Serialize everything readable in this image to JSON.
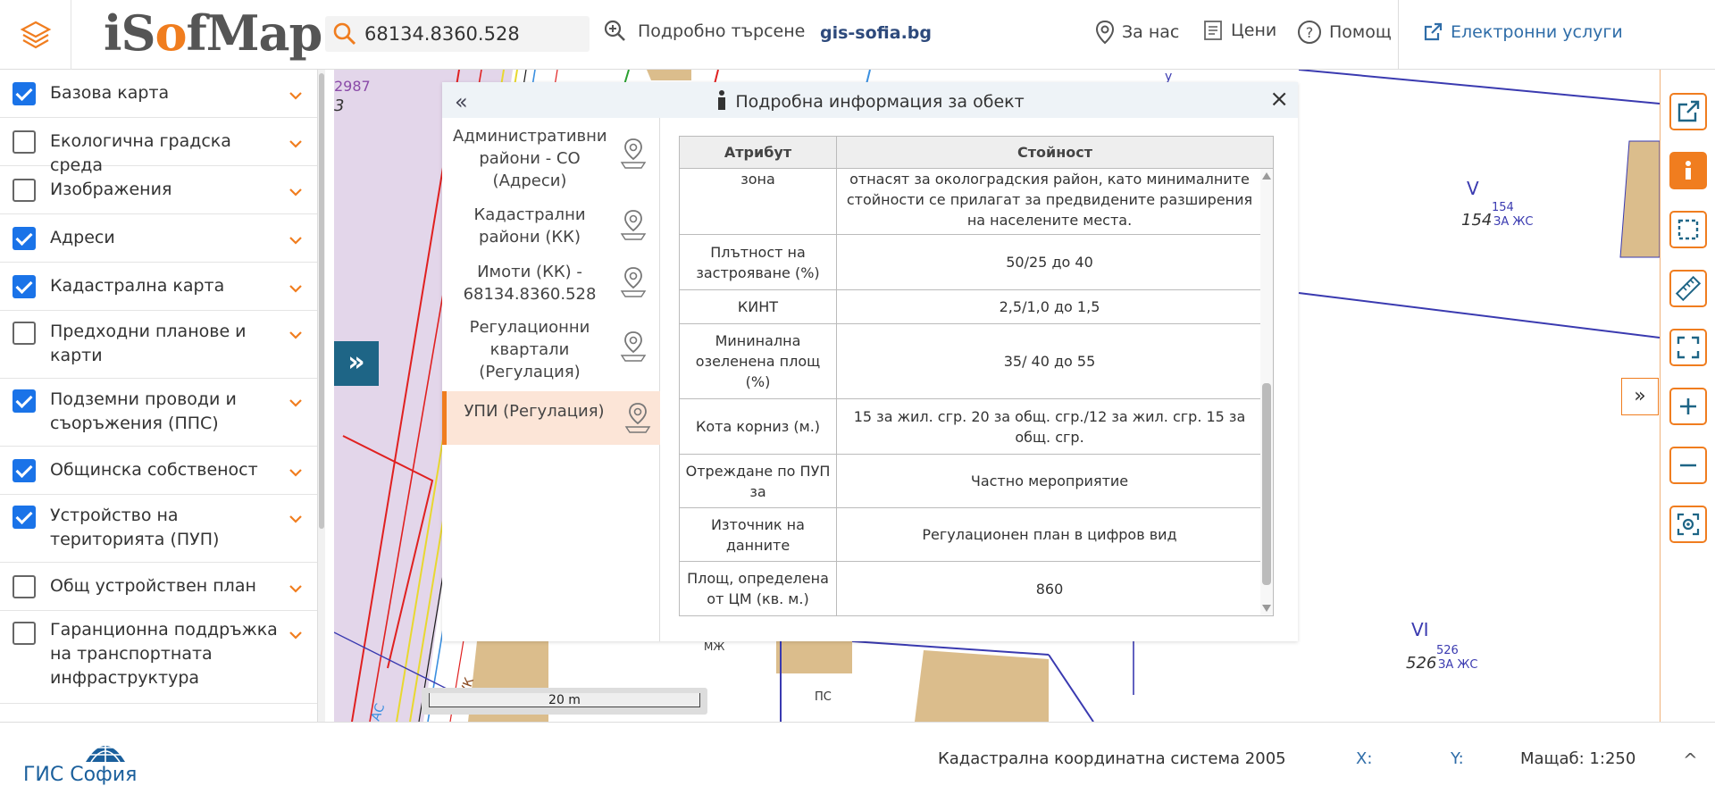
{
  "header": {
    "logo_prefix": "iS",
    "logo_o": "o",
    "logo_suffix": "fMap",
    "search_value": "68134.8360.528",
    "advanced_search": "Подробно търсене",
    "gis_link": "gis-sofia.bg",
    "about": "За нас",
    "prices": "Цени",
    "help": "Помощ",
    "eservices": "Електронни услуги"
  },
  "sidebar": {
    "layers": [
      {
        "label": "Базова карта",
        "checked": true
      },
      {
        "label": "Екологична градска среда",
        "checked": false
      },
      {
        "label": "Изображения",
        "checked": false
      },
      {
        "label": "Адреси",
        "checked": true
      },
      {
        "label": "Кадастрална карта",
        "checked": true
      },
      {
        "label": "Предходни планове и карти",
        "checked": false
      },
      {
        "label": "Подземни проводи и съоръжения (ППС)",
        "checked": true
      },
      {
        "label": "Общинска собственост",
        "checked": true
      },
      {
        "label": "Устройство на територията (ПУП)",
        "checked": true
      },
      {
        "label": "Общ устройствен план",
        "checked": false
      },
      {
        "label": "Гаранционна поддръжка на транспортната инфраструктура",
        "checked": false
      }
    ]
  },
  "panel": {
    "collapse": "«",
    "title": "Подробна информация за обект",
    "close": "×",
    "items": [
      {
        "label": "Административни райони - СО (Адреси)"
      },
      {
        "label": "Кадастрални райони (КК)"
      },
      {
        "label": "Имоти (КК) - 68134.8360.528"
      },
      {
        "label": "Регулационни квартали (Регулация)"
      },
      {
        "label": "УПИ (Регулация)"
      }
    ],
    "table": {
      "col_attr": "Атрибут",
      "col_value": "Стойност",
      "rows": [
        {
          "attr": "зона",
          "value": "отнасят за околоградския район, като минималните стойности се прилагат за предвидените разширения на населените места."
        },
        {
          "attr": "Плътност на застрояване (%)",
          "value": "50/25 до 40"
        },
        {
          "attr": "КИНТ",
          "value": "2,5/1,0 до 1,5"
        },
        {
          "attr": "Мининална озеленена площ (%)",
          "value": "35/ 40 до 55"
        },
        {
          "attr": "Кота корниз (м.)",
          "value": "15 за жил. сгр. 20 за общ. сгр./12 за жил. сгр. 15 за общ. сгр."
        },
        {
          "attr": "Отреждане по ПУП за",
          "value": "Частно мероприятие"
        },
        {
          "attr": "Източник на данните",
          "value": "Регулационен план в цифров вид"
        },
        {
          "attr": "Площ, определена от ЦМ (кв. м.)",
          "value": "860"
        }
      ]
    }
  },
  "map": {
    "labels": {
      "num_2987": "2987",
      "num_3": "3",
      "V": "V",
      "v_num": "154",
      "v_sub": "154",
      "v_zone": "ЗА ЖС",
      "VI": "VI",
      "vi_num": "526",
      "vi_sub": "526",
      "vi_zone": "ЗА ЖС",
      "mzh": "МЖ",
      "ps": "ПС",
      "u": "у",
      "uk": "УК",
      "ac": "АС"
    },
    "scale_label": "20 m",
    "expand": "»",
    "right_expand": "»"
  },
  "footer": {
    "logo_text": "ГИС София",
    "crs": "Кадастрална координатна система 2005",
    "x_label": "X:",
    "y_label": "Y:",
    "scale": "Мащаб: 1:250",
    "toggle": "^"
  },
  "colors": {
    "accent": "#f07d1f",
    "checkbox": "#1a73e8",
    "link": "#2f6da8"
  }
}
